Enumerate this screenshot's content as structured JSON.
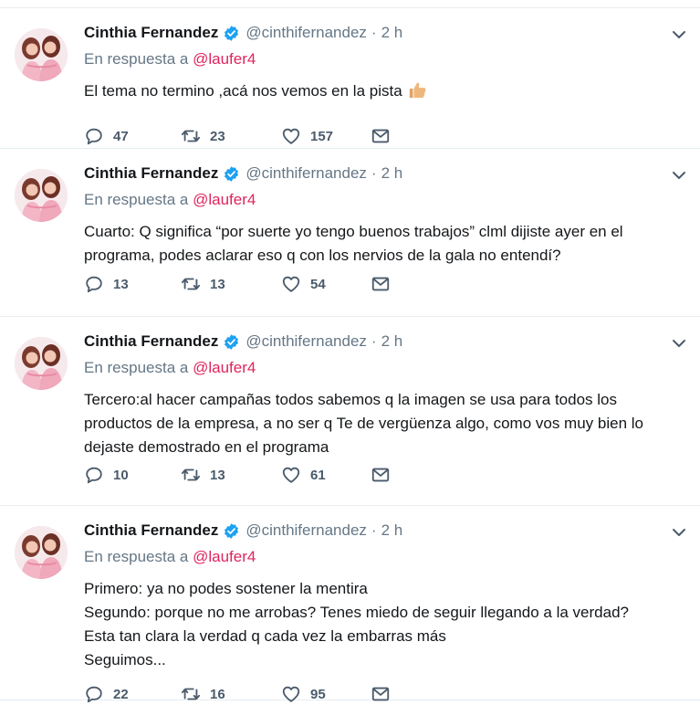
{
  "tweets": [
    {
      "name": "Cinthia Fernandez",
      "handle": "@cinthifernandez",
      "separator": "·",
      "time": "2 h",
      "reply_prefix": "En respuesta a",
      "reply_to": "@laufer4",
      "lines": [
        "El tema no termino ,acá nos vemos en la pista"
      ],
      "emoji": "thumbs-up-icon",
      "replies": "47",
      "retweets": "23",
      "likes": "157"
    },
    {
      "name": "Cinthia Fernandez",
      "handle": "@cinthifernandez",
      "separator": "·",
      "time": "2 h",
      "reply_prefix": "En respuesta a",
      "reply_to": "@laufer4",
      "lines": [
        "Cuarto: Q significa “por suerte yo tengo buenos trabajos” clml dijiste ayer en el",
        "programa, podes aclarar eso q con los nervios de la gala no entendí?"
      ],
      "replies": "13",
      "retweets": "13",
      "likes": "54"
    },
    {
      "name": "Cinthia Fernandez",
      "handle": "@cinthifernandez",
      "separator": "·",
      "time": "2 h",
      "reply_prefix": "En respuesta a",
      "reply_to": "@laufer4",
      "lines": [
        "Tercero:al hacer campañas todos sabemos q la imagen se usa para todos los",
        "productos de la empresa, a no ser q Te de vergüenza algo, como vos muy bien lo",
        "dejaste demostrado en el programa"
      ],
      "replies": "10",
      "retweets": "13",
      "likes": "61"
    },
    {
      "name": "Cinthia Fernandez",
      "handle": "@cinthifernandez",
      "separator": "·",
      "time": "2 h",
      "reply_prefix": "En respuesta a",
      "reply_to": "@laufer4",
      "lines": [
        "Primero: ya no podes sostener la mentira",
        "Segundo: porque no me arrobas? Tenes miedo de seguir llegando a la verdad?",
        "Esta tan clara la verdad q cada vez la embarras más",
        "Seguimos..."
      ],
      "replies": "22",
      "retweets": "16",
      "likes": "95"
    }
  ],
  "colors": {
    "text": "#14171a",
    "muted": "#657786",
    "mention": "#e0245e",
    "verified": "#1da1f2",
    "divider": "#e6ecf0"
  },
  "icons": [
    "verified-badge-icon",
    "chevron-down-icon",
    "reply-icon",
    "retweet-icon",
    "like-icon",
    "direct-message-icon"
  ]
}
